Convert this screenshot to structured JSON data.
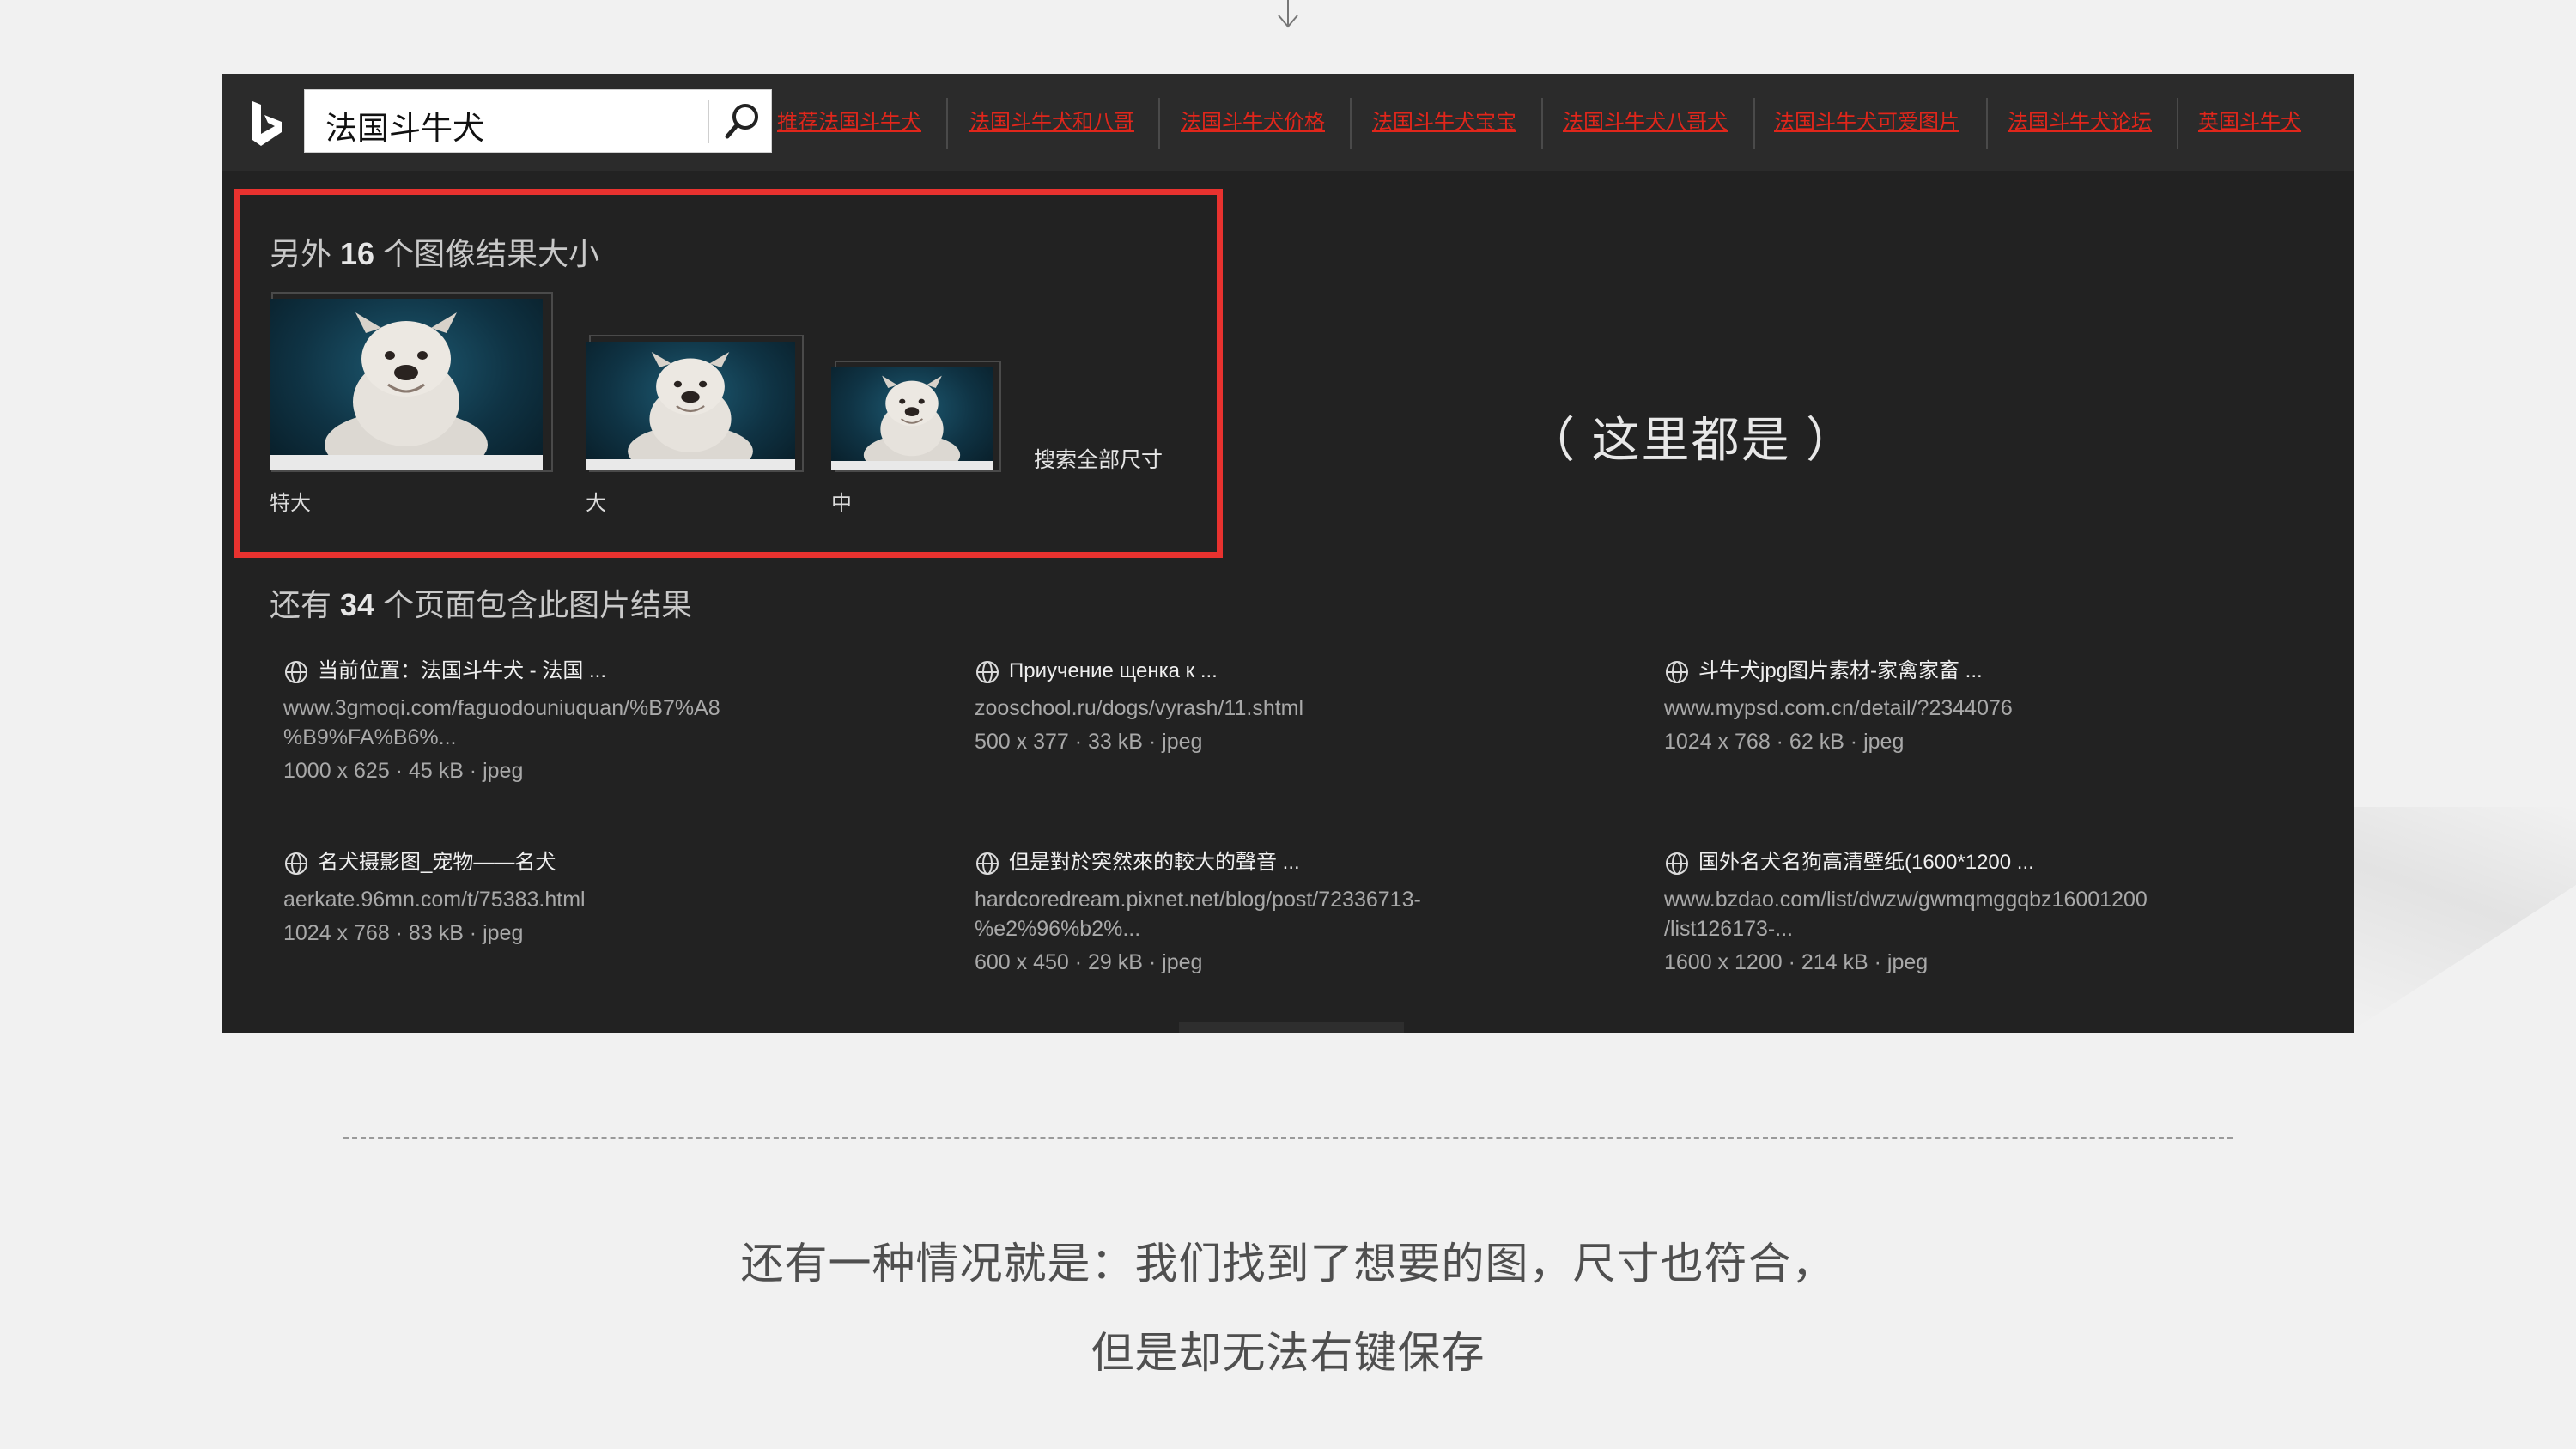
{
  "search": {
    "query": "法国斗牛犬"
  },
  "related_searches": [
    "推荐法国斗牛犬",
    "法国斗牛犬和八哥",
    "法国斗牛犬价格",
    "法国斗牛犬宝宝",
    "法国斗牛犬八哥犬",
    "法国斗牛犬可爱图片",
    "法国斗牛犬论坛",
    "英国斗牛犬"
  ],
  "sizes_section": {
    "title_prefix": "另外",
    "count": "16",
    "title_suffix": "个图像结果大小",
    "thumbnails": [
      {
        "label": "特大"
      },
      {
        "label": "大"
      },
      {
        "label": "中"
      }
    ],
    "search_all_label": "搜索全部尺寸"
  },
  "annotation": "（ 这里都是 ）",
  "pages_section": {
    "title_prefix": "还有",
    "count": "34",
    "title_suffix": "个页面包含此图片结果",
    "results": [
      {
        "title": "当前位置：法国斗牛犬 - 法国 ...",
        "url_lines": [
          "www.3gmoqi.com/faguodouniuquan/%B7%A8",
          "%B9%FA%B6%..."
        ],
        "meta": "1000 x 625 · 45 kB · jpeg"
      },
      {
        "title": "Приучение щенка к ...",
        "url_lines": [
          "zooschool.ru/dogs/vyrash/11.shtml"
        ],
        "meta": "500 x 377 · 33 kB · jpeg"
      },
      {
        "title": "斗牛犬jpg图片素材-家禽家畜 ...",
        "url_lines": [
          "www.mypsd.com.cn/detail/?2344076"
        ],
        "meta": "1024 x 768 · 62 kB · jpeg"
      },
      {
        "title": "名犬摄影图_宠物——名犬",
        "url_lines": [
          "aerkate.96mn.com/t/75383.html"
        ],
        "meta": "1024 x 768 · 83 kB · jpeg"
      },
      {
        "title": "但是對於突然來的較大的聲音 ...",
        "url_lines": [
          "hardcoredream.pixnet.net/blog/post/72336713-",
          "%e2%96%b2%..."
        ],
        "meta": "600 x 450 · 29 kB · jpeg"
      },
      {
        "title": "国外名犬名狗高清壁纸(1600*1200 ...",
        "url_lines": [
          "www.bzdao.com/list/dwzw/gwmqmggqbz16001200",
          "/list126173-..."
        ],
        "meta": "1600 x 1200 · 214 kB · jpeg"
      }
    ]
  },
  "captions": {
    "line1": "还有一种情况就是：我们找到了想要的图，尺寸也符合，",
    "line2": "但是却无法右键保存"
  },
  "colors": {
    "page_bg": "#f1f1f1",
    "panel_bg": "#222222",
    "topbar_bg": "#2b2b2b",
    "highlight_border": "#e8322f",
    "related_link": "#e0261b"
  }
}
